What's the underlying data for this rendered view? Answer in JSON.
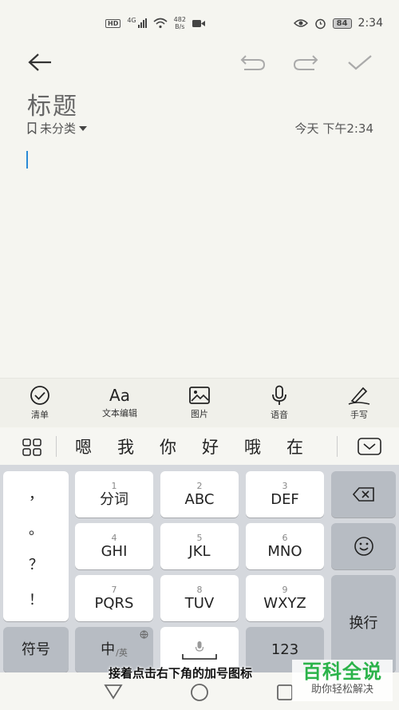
{
  "status": {
    "network": "4G",
    "hd": "HD",
    "rate_value": "482",
    "rate_unit": "B/s",
    "battery": "84",
    "time": "2:34"
  },
  "note": {
    "title_placeholder": "标题",
    "category": "未分类",
    "timestamp": "今天 下午2:34"
  },
  "tools": [
    {
      "label": "清单",
      "icon": "checklist-icon"
    },
    {
      "label": "文本编辑",
      "icon": "text-format-icon",
      "glyph": "Aa"
    },
    {
      "label": "图片",
      "icon": "image-icon"
    },
    {
      "label": "语音",
      "icon": "microphone-icon"
    },
    {
      "label": "手写",
      "icon": "handwriting-icon"
    }
  ],
  "candidates": [
    "嗯",
    "我",
    "你",
    "好",
    "哦",
    "在"
  ],
  "keyboard": {
    "punct": [
      "，",
      "。",
      "？",
      "！"
    ],
    "keys": [
      {
        "num": "1",
        "label": "分词"
      },
      {
        "num": "2",
        "label": "ABC"
      },
      {
        "num": "3",
        "label": "DEF"
      },
      {
        "num": "4",
        "label": "GHI"
      },
      {
        "num": "5",
        "label": "JKL"
      },
      {
        "num": "6",
        "label": "MNO"
      },
      {
        "num": "7",
        "label": "PQRS"
      },
      {
        "num": "8",
        "label": "TUV"
      },
      {
        "num": "9",
        "label": "WXYZ"
      }
    ],
    "enter": "换行",
    "symbols": "符号",
    "lang_main": "中",
    "lang_alt": "/英",
    "digits": "123"
  },
  "overlay": {
    "caption": "接着点击右下角的加号图标",
    "brand_title": "百科全说",
    "brand_sub": "助你轻松解决"
  }
}
